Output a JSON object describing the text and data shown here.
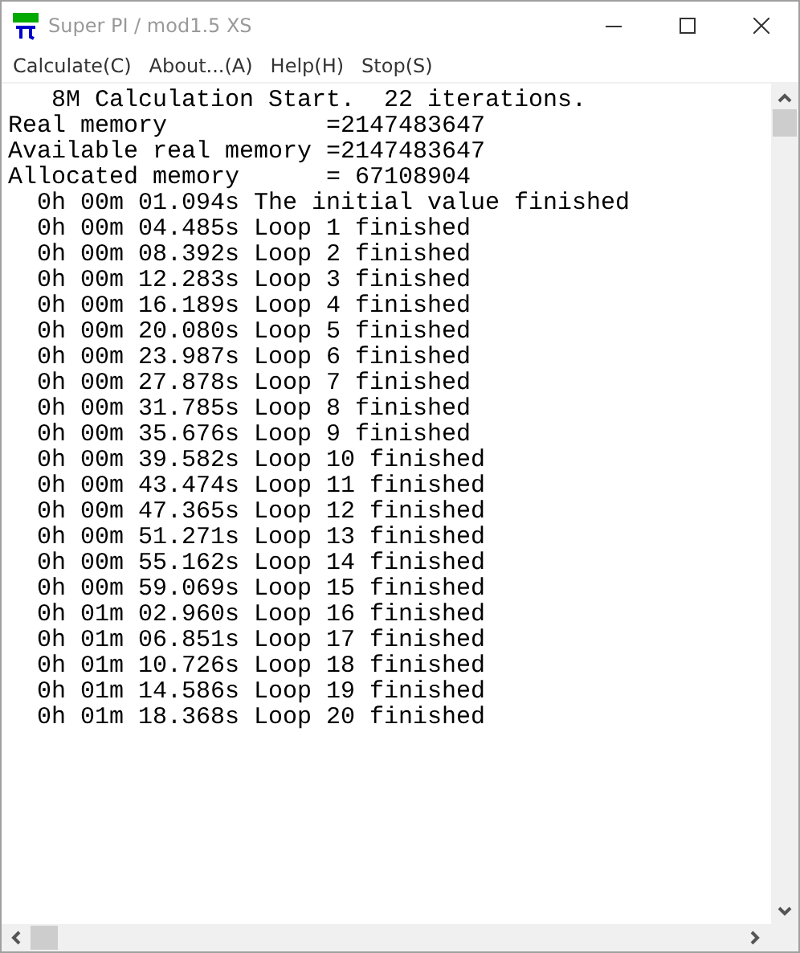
{
  "window": {
    "title": "Super PI / mod1.5 XS"
  },
  "menu": [
    "Calculate(C)",
    "About...(A)",
    "Help(H)",
    "Stop(S)"
  ],
  "console_lines": [
    "   8M Calculation Start.  22 iterations.",
    "Real memory           =2147483647",
    "Available real memory =2147483647",
    "Allocated memory      = 67108904",
    "  0h 00m 01.094s The initial value finished",
    "  0h 00m 04.485s Loop 1 finished",
    "  0h 00m 08.392s Loop 2 finished",
    "  0h 00m 12.283s Loop 3 finished",
    "  0h 00m 16.189s Loop 4 finished",
    "  0h 00m 20.080s Loop 5 finished",
    "  0h 00m 23.987s Loop 6 finished",
    "  0h 00m 27.878s Loop 7 finished",
    "  0h 00m 31.785s Loop 8 finished",
    "  0h 00m 35.676s Loop 9 finished",
    "  0h 00m 39.582s Loop 10 finished",
    "  0h 00m 43.474s Loop 11 finished",
    "  0h 00m 47.365s Loop 12 finished",
    "  0h 00m 51.271s Loop 13 finished",
    "  0h 00m 55.162s Loop 14 finished",
    "  0h 00m 59.069s Loop 15 finished",
    "  0h 01m 02.960s Loop 16 finished",
    "  0h 01m 06.851s Loop 17 finished",
    "  0h 01m 10.726s Loop 18 finished",
    "  0h 01m 14.586s Loop 19 finished",
    "  0h 01m 18.368s Loop 20 finished"
  ]
}
